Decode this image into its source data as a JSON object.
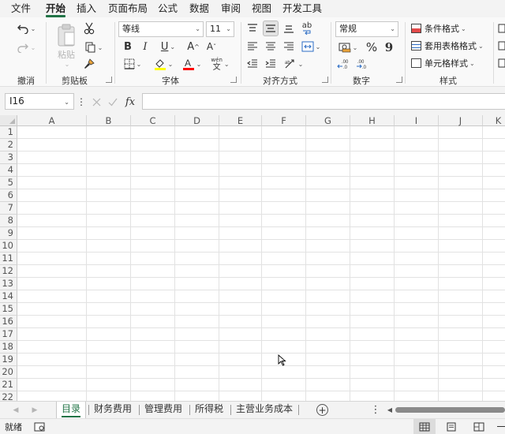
{
  "menu": {
    "items": [
      "文件",
      "开始",
      "插入",
      "页面布局",
      "公式",
      "数据",
      "审阅",
      "视图",
      "开发工具"
    ],
    "active_index": 1
  },
  "ribbon": {
    "undo_group_label": "撤消",
    "clipboard": {
      "paste_label": "粘贴",
      "group_label": "剪贴板"
    },
    "font": {
      "name": "等线",
      "size": "11",
      "bold_label": "B",
      "italic_label": "I",
      "underline_label": "U",
      "grow_label": "A",
      "shrink_label": "A",
      "phonetic_top": "wén",
      "phonetic_bottom": "文",
      "group_label": "字体",
      "highlight_color": "#ffff00",
      "font_color": "#ff0000"
    },
    "alignment": {
      "wrap_label": "ab",
      "group_label": "对齐方式"
    },
    "number": {
      "format": "常规",
      "percent_label": "%",
      "comma_label": "9",
      "group_label": "数字"
    },
    "styles": {
      "conditional_label": "条件格式",
      "table_label": "套用表格格式",
      "cell_label": "单元格样式",
      "group_label": "样式"
    }
  },
  "formula_bar": {
    "name_box": "I16",
    "fx_label": "fx",
    "value": ""
  },
  "grid": {
    "columns": [
      "A",
      "B",
      "C",
      "D",
      "E",
      "F",
      "G",
      "H",
      "I",
      "J",
      "K"
    ],
    "rows": [
      "1",
      "2",
      "3",
      "4",
      "5",
      "6",
      "7",
      "8",
      "9",
      "10",
      "11",
      "12",
      "13",
      "14",
      "15",
      "16",
      "17",
      "18",
      "19",
      "20",
      "21",
      "22"
    ]
  },
  "sheets": {
    "tabs": [
      "目录",
      "财务费用",
      "管理费用",
      "所得税",
      "主营业务成本"
    ],
    "active_index": 0,
    "add_label": "+"
  },
  "status": {
    "ready_label": "就绪"
  },
  "colors": {
    "accent": "#217346",
    "menu_bg": "#f3f3f3",
    "ribbon_bg": "#f9f9f9"
  }
}
